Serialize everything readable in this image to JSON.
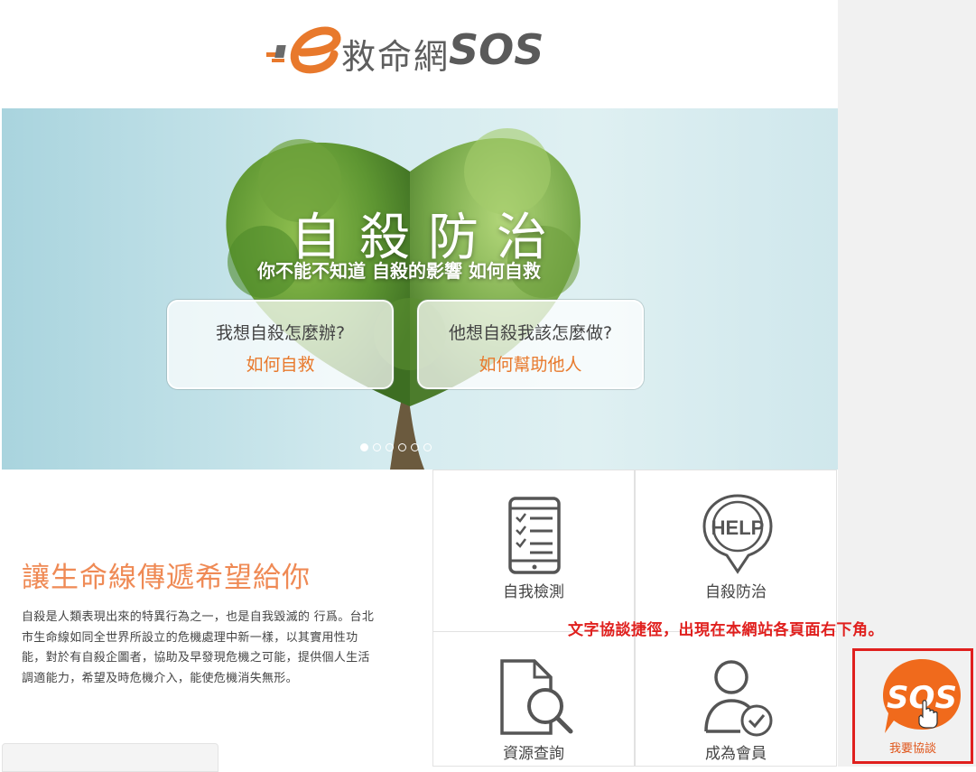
{
  "header": {
    "logo_mark": "e",
    "logo_text": "救命網",
    "logo_sos": "SOS"
  },
  "hero": {
    "title": "自殺防治",
    "subtitle": "你不能不知道 自殺的影響 如何自救",
    "buttons": [
      {
        "question": "我想自殺怎麼辦?",
        "action": "如何自救"
      },
      {
        "question": "他想自殺我該怎麼做?",
        "action": "如何幫助他人"
      }
    ],
    "slides": 6,
    "active_slide": 1
  },
  "intro": {
    "slogan": "讓生命線傳遞希望給你",
    "body": "自殺是人類表現出來的特異行為之一，也是自我毀滅的 行爲。台北市生命線如同全世界所設立的危機處理中新一樣，以其實用性功能，對於有自殺企圖者，協助及早發現危機之可能，提供個人生活調適能力，希望及時危機介入，能使危機消失無形。"
  },
  "tiles": [
    {
      "label": "自我檢測",
      "icon": "checklist-phone-icon"
    },
    {
      "label": "自殺防治",
      "icon": "help-bubble-icon"
    },
    {
      "label": "資源查詢",
      "icon": "document-search-icon"
    },
    {
      "label": "成為會員",
      "icon": "member-check-icon"
    }
  ],
  "annotation": {
    "note": "文字協談捷徑，出現在本網站各頁面右下角。"
  },
  "sos_widget": {
    "badge": "SOS",
    "label": "我要協談"
  },
  "colors": {
    "accent_orange": "#e8792c",
    "annotation_red": "#e0201e",
    "sos_orange": "#f06a1c"
  }
}
